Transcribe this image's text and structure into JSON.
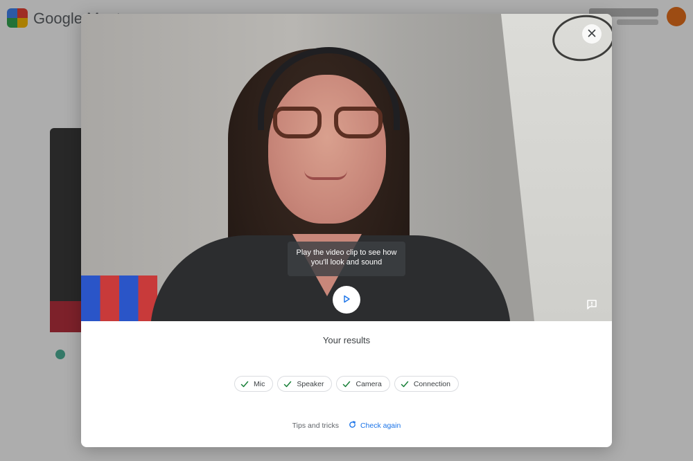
{
  "background_app": {
    "logo_text": "Google Meet",
    "avatar_color": "#e8711c"
  },
  "dialog": {
    "close_icon": "close-icon",
    "video_hint": "Play the video clip to see how you'll look and sound",
    "play_icon": "play-icon",
    "feedback_icon": "feedback-icon",
    "results_title": "Your results",
    "checks": [
      {
        "label": "Mic",
        "icon": "check-icon"
      },
      {
        "label": "Speaker",
        "icon": "check-icon"
      },
      {
        "label": "Camera",
        "icon": "check-icon"
      },
      {
        "label": "Connection",
        "icon": "check-icon"
      }
    ],
    "tips_label": "Tips and tricks",
    "check_again_label": "Check again",
    "check_again_icon": "refresh-icon"
  },
  "colors": {
    "accent": "#1a73e8",
    "check_green": "#188038",
    "overlay": "rgba(0,0,0,0.32)"
  }
}
